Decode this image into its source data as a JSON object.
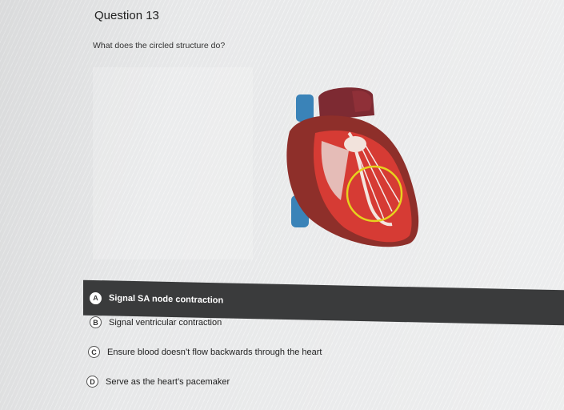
{
  "question": {
    "title": "Question 13",
    "prompt": "What does the circled structure do?"
  },
  "choices": [
    {
      "letter": "A",
      "label": "Signal SA node contraction",
      "selected": true
    },
    {
      "letter": "B",
      "label": "Signal ventricular contraction",
      "selected": false
    },
    {
      "letter": "C",
      "label": "Ensure blood doesn’t flow backwards through the heart",
      "selected": false
    },
    {
      "letter": "D",
      "label": "Serve as the heart’s pacemaker",
      "selected": false
    }
  ],
  "image": {
    "subject": "heart-cross-section-illustration",
    "highlight_color": "#e6d21e"
  }
}
